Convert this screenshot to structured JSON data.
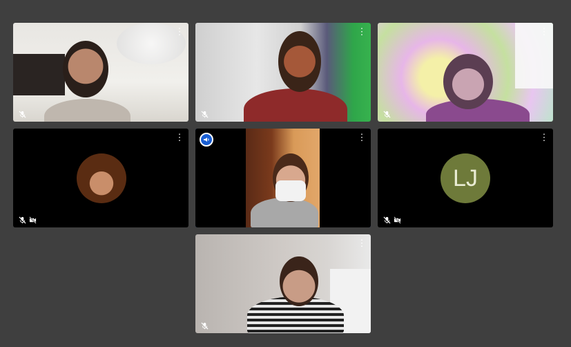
{
  "meeting": {
    "tiles": [
      {
        "id": "participant-1",
        "muted": true,
        "camera_off": false
      },
      {
        "id": "participant-2",
        "muted": true,
        "camera_off": false
      },
      {
        "id": "participant-3",
        "muted": true,
        "camera_off": false
      },
      {
        "id": "participant-4",
        "muted": true,
        "camera_off": true
      },
      {
        "id": "participant-5",
        "muted": false,
        "camera_off": false,
        "speaking": true
      },
      {
        "id": "participant-6",
        "muted": true,
        "camera_off": true,
        "initials": "LJ"
      },
      {
        "id": "participant-7",
        "muted": true,
        "camera_off": false
      }
    ],
    "more_options_glyph": "⋮",
    "icons": {
      "mic_off": "mic-off-icon",
      "camera_off": "camera-off-icon",
      "more": "more-options-icon",
      "speaker": "speaker-highlight-icon"
    },
    "colors": {
      "background": "#3f3f3f",
      "speaking_border": "#1a5fd3",
      "avatar_initials_bg": "#6e7a3a"
    }
  }
}
